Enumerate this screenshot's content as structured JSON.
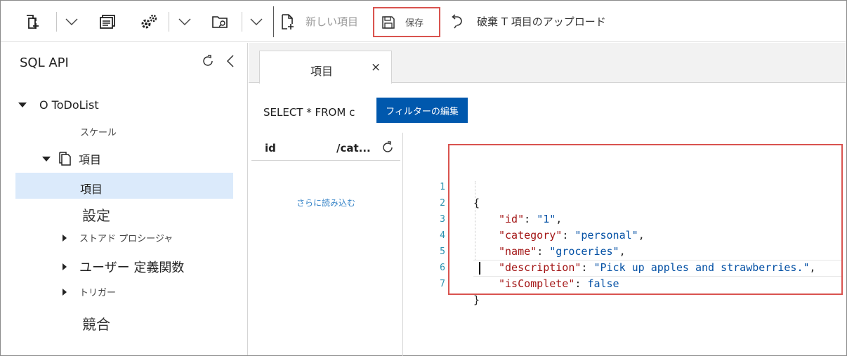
{
  "toolbar": {
    "new_item_label": "新しい項目",
    "save_label": "保存",
    "discard_upload_label": "破棄 T 項目のアップロード"
  },
  "sidebar": {
    "title": "SQL API",
    "container": "O ToDoList",
    "scale": "スケール",
    "items_node": "項目",
    "items_selected": "項目",
    "settings": "設定",
    "stored_procedures": "ストアド プロシージャ",
    "udf": "ユーザー 定義関数",
    "triggers": "トリガー",
    "conflicts": "競合"
  },
  "tab": {
    "label": "項目",
    "close": "×"
  },
  "query": {
    "text": "SELECT * FROM c",
    "filter_button": "フィルターの編集"
  },
  "list": {
    "col_id": "id",
    "col_category": "/cat...",
    "load_more": "さらに読み込む"
  },
  "editor": {
    "line_numbers": [
      "1",
      "2",
      "3",
      "4",
      "5",
      "6",
      "7"
    ],
    "open_brace": "{",
    "close_brace": "}",
    "fields": [
      {
        "key": "\"id\"",
        "value": "\"1\"",
        "comma": ","
      },
      {
        "key": "\"category\"",
        "value": "\"personal\"",
        "comma": ","
      },
      {
        "key": "\"name\"",
        "value": "\"groceries\"",
        "comma": ","
      },
      {
        "key": "\"description\"",
        "value": "\"Pick up apples and strawberries.\"",
        "comma": ","
      },
      {
        "key": "\"isComplete\"",
        "value": "false",
        "comma": ""
      }
    ]
  },
  "colors": {
    "accent": "#0058ad",
    "highlight": "#d9534f",
    "selection": "#dbeafb"
  }
}
